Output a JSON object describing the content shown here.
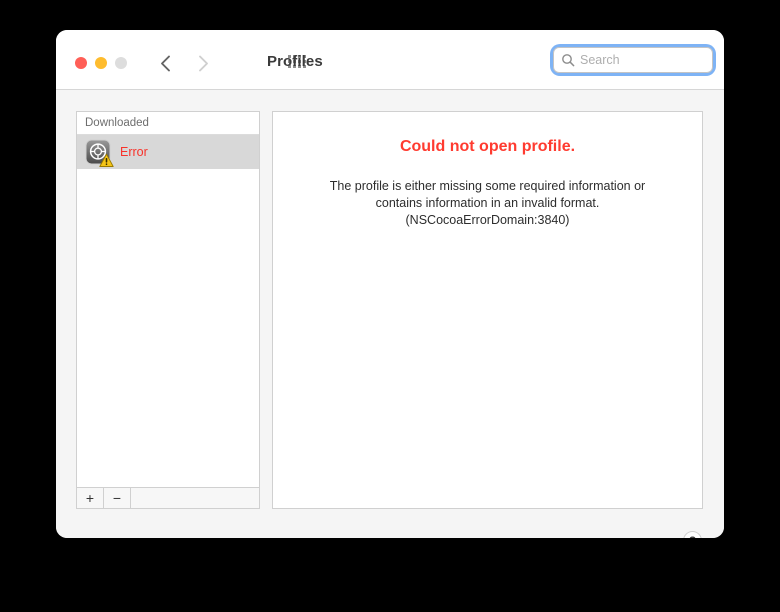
{
  "window": {
    "title": "Profiles",
    "traffic_lights": [
      {
        "name": "close",
        "color": "#ff5f57"
      },
      {
        "name": "minimize",
        "color": "#febc2e"
      },
      {
        "name": "zoom",
        "color": "#dddddd"
      }
    ]
  },
  "toolbar": {
    "back_label": "‹",
    "forward_label": "›",
    "show_all_label": "Show All"
  },
  "search": {
    "value": "",
    "placeholder": "Search"
  },
  "sidebar": {
    "header": "Downloaded",
    "items": [
      {
        "label": "Error",
        "icon": "profile-warning-icon",
        "selected": true,
        "color": "#f8322a"
      }
    ],
    "footer": {
      "add_label": "+",
      "remove_label": "−"
    }
  },
  "content": {
    "error_title": "Could not open profile.",
    "error_line1": "The profile is either missing some required information or",
    "error_line2": "contains information in an invalid format.",
    "error_line3": "(NSCocoaErrorDomain:3840)"
  },
  "help": {
    "label": "?"
  },
  "colors": {
    "error_red": "#ff3b30",
    "focus_ring": "#7eb3f5",
    "selection_gray": "#d8d8d8"
  }
}
